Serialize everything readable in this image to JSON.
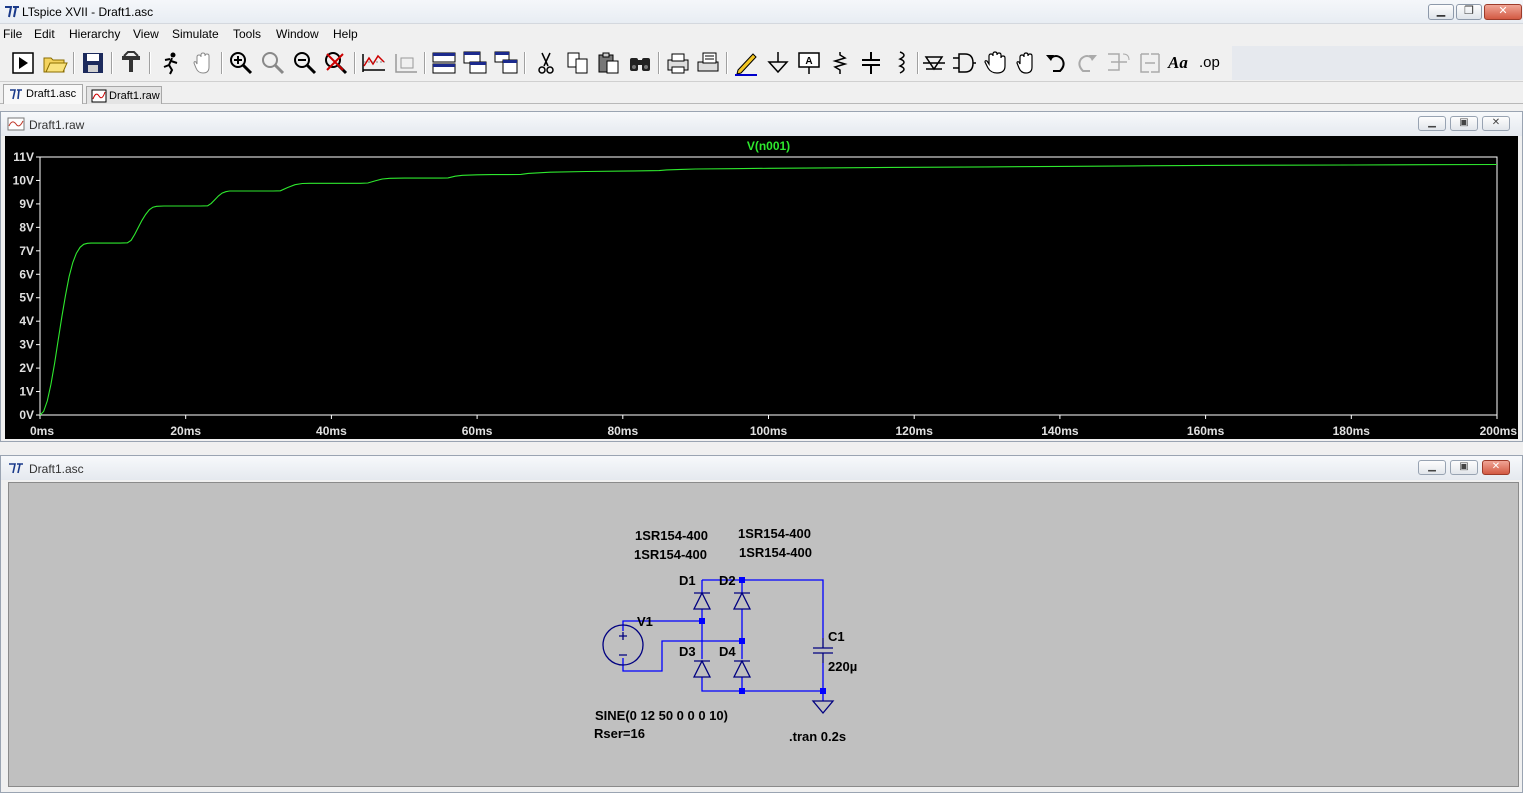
{
  "app": {
    "title": "LTspice XVII - Draft1.asc",
    "window_buttons": [
      "minimize",
      "restore",
      "close"
    ]
  },
  "menu": [
    "File",
    "Edit",
    "Hierarchy",
    "View",
    "Simulate",
    "Tools",
    "Window",
    "Help"
  ],
  "toolbar": {
    "icons": [
      "run-icon",
      "open-icon",
      "save-icon",
      "control-panel-icon",
      "halt-icon",
      "pan-hand-icon",
      "zoom-in-icon",
      "zoom-full-icon",
      "zoom-out-icon",
      "zoom-cancel-icon",
      "autorange-icon",
      "plot-settings-icon",
      "tile-horizontal-icon",
      "cascade-icon",
      "tile-vertical-icon",
      "cut-icon",
      "copy-icon",
      "paste-icon",
      "find-icon",
      "print-icon",
      "print-setup-icon",
      "draw-wire-icon",
      "ground-icon",
      "label-net-icon",
      "resistor-icon",
      "capacitor-icon",
      "inductor-icon",
      "diode-icon",
      "component-icon",
      "move-icon",
      "drag-icon",
      "undo-icon",
      "redo-icon",
      "rotate-icon",
      "mirror-icon",
      "text-icon",
      "spice-directive-icon"
    ],
    "text_label": "Aa",
    "op_label": ".op"
  },
  "tabs": [
    {
      "label": "Draft1.asc",
      "icon": "schematic-icon"
    },
    {
      "label": "Draft1.raw",
      "icon": "waveform-icon"
    }
  ],
  "plot_window": {
    "title": "Draft1.raw",
    "trace_label": "V(n001)",
    "colors": {
      "background": "#000000",
      "trace": "#2ee82e",
      "axis_text": "#e0e0e0"
    }
  },
  "chart_data": {
    "type": "line",
    "title": "V(n001)",
    "xlabel": "",
    "ylabel": "",
    "xlim": [
      0,
      200
    ],
    "ylim": [
      0,
      11
    ],
    "x_ticks": [
      "0ms",
      "20ms",
      "40ms",
      "60ms",
      "80ms",
      "100ms",
      "120ms",
      "140ms",
      "160ms",
      "180ms",
      "200ms"
    ],
    "y_ticks": [
      "0V",
      "1V",
      "2V",
      "3V",
      "4V",
      "5V",
      "6V",
      "7V",
      "8V",
      "9V",
      "10V",
      "11V"
    ],
    "series": [
      {
        "name": "V(n001)",
        "x": [
          0,
          0.5,
          1,
          1.5,
          2,
          2.5,
          3,
          3.5,
          4,
          4.5,
          5,
          5.5,
          6,
          6.5,
          7,
          8,
          9,
          10,
          11,
          12,
          12.5,
          13,
          13.5,
          14,
          14.5,
          15,
          15.5,
          16,
          17,
          18,
          19,
          20,
          21,
          22,
          23,
          23.5,
          24,
          24.5,
          25,
          25.5,
          26,
          27,
          28,
          30,
          32,
          33,
          34,
          35,
          36,
          37,
          38,
          40,
          42,
          44,
          45,
          46,
          47,
          48,
          50,
          52,
          54,
          55,
          56,
          57,
          58,
          60,
          62,
          64,
          66,
          67,
          70,
          75,
          80,
          85,
          86,
          88,
          90,
          95,
          100,
          110,
          120,
          130,
          140,
          150,
          160,
          170,
          180,
          190,
          200
        ],
        "values": [
          0,
          0.15,
          0.6,
          1.3,
          2.2,
          3.2,
          4.2,
          5.1,
          5.9,
          6.5,
          6.9,
          7.15,
          7.28,
          7.32,
          7.33,
          7.33,
          7.33,
          7.33,
          7.33,
          7.34,
          7.45,
          7.7,
          8.0,
          8.3,
          8.55,
          8.75,
          8.86,
          8.9,
          8.91,
          8.91,
          8.91,
          8.91,
          8.91,
          8.91,
          8.92,
          9.02,
          9.18,
          9.34,
          9.46,
          9.52,
          9.55,
          9.55,
          9.55,
          9.55,
          9.55,
          9.56,
          9.7,
          9.82,
          9.87,
          9.88,
          9.88,
          9.88,
          9.88,
          9.88,
          9.89,
          9.98,
          10.06,
          10.09,
          10.1,
          10.1,
          10.1,
          10.1,
          10.11,
          10.18,
          10.22,
          10.24,
          10.25,
          10.25,
          10.26,
          10.3,
          10.35,
          10.38,
          10.4,
          10.42,
          10.45,
          10.47,
          10.49,
          10.5,
          10.52,
          10.54,
          10.56,
          10.58,
          10.6,
          10.62,
          10.64,
          10.65,
          10.66,
          10.67,
          10.68
        ]
      }
    ],
    "grid": false,
    "legend": "top-center"
  },
  "schematic_window": {
    "title": "Draft1.asc",
    "labels": {
      "d1_model": "1SR154-400",
      "d3_model": "1SR154-400",
      "d2_model": "1SR154-400",
      "d4_model": "1SR154-400",
      "d1": "D1",
      "d2": "D2",
      "d3": "D3",
      "d4": "D4",
      "v1": "V1",
      "c1": "C1",
      "c1_value": "220µ",
      "source_value": "SINE(0 12 50 0 0 0 10)",
      "source_rser": "Rser=16",
      "directive": ".tran 0.2s"
    },
    "colors": {
      "wire": "#0000ff",
      "symbol": "#000080",
      "background": "#c0c0c0"
    }
  }
}
